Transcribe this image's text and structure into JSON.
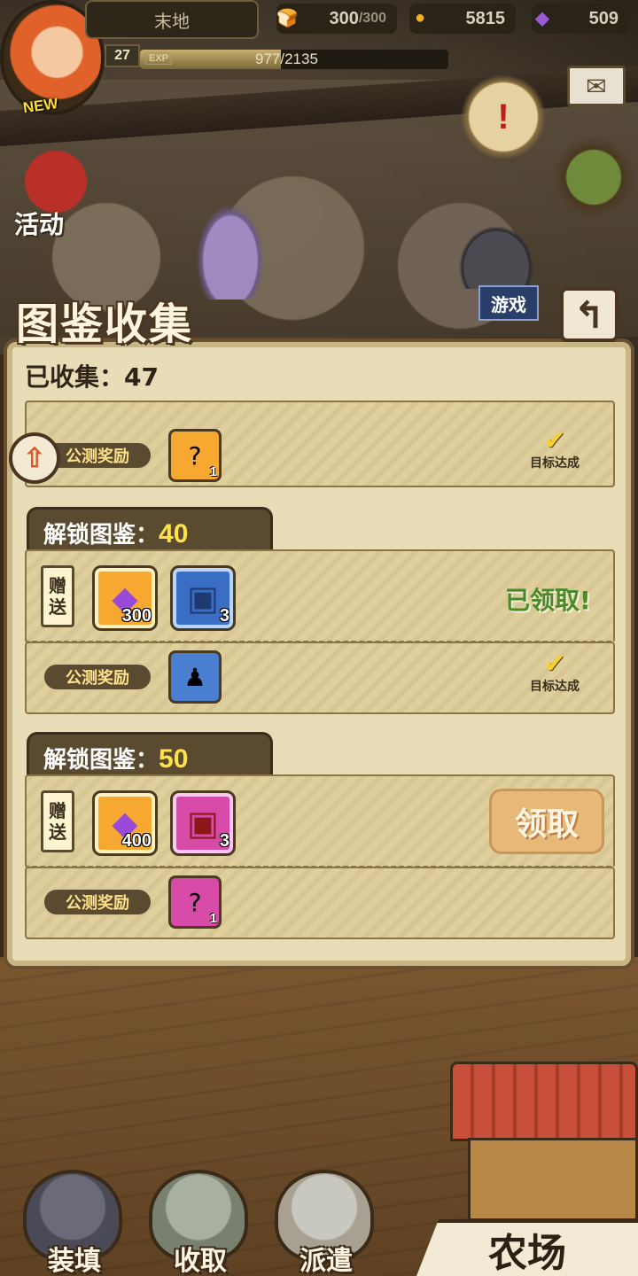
{
  "player": {
    "name": "末地",
    "new_badge": "NEW",
    "level": "27",
    "exp_label": "EXP",
    "exp_text": "977/2135",
    "exp_fraction": 0.4577
  },
  "resources": {
    "stamina": "300",
    "stamina_max": "/300",
    "gold": "5815",
    "gems": "509"
  },
  "side": {
    "event_label": "活动",
    "game_sign": "游戏"
  },
  "panel": {
    "title": "图鉴收集",
    "collected": "已收集：47",
    "tiers": [
      {
        "unlock_label": "解锁图鉴：",
        "unlock_num": "40",
        "gift_tag": [
          "赠",
          "送"
        ],
        "items": [
          {
            "type": "gem",
            "qty": "300"
          },
          {
            "type": "chest-blue",
            "qty": "3"
          }
        ],
        "status": "已领取!",
        "reward_tag": "公测奖励",
        "reward_achieved": "目标达成"
      },
      {
        "unlock_label": "解锁图鉴：",
        "unlock_num": "50",
        "gift_tag": [
          "赠",
          "送"
        ],
        "items": [
          {
            "type": "gem",
            "qty": "400"
          },
          {
            "type": "chest-red",
            "qty": "3"
          }
        ],
        "claim_button": "领取",
        "reward_tag": "公测奖励",
        "reward_qty": "1"
      }
    ],
    "prev_reward": {
      "reward_tag": "公测奖励",
      "qty": "1",
      "achieved": "目标达成"
    }
  },
  "nav": {
    "load": "装填",
    "collect": "收取",
    "dispatch": "派遣",
    "farm": "农场"
  },
  "colors": {
    "accent_yellow": "#ffe24a",
    "claimed_green": "#4a8a2a",
    "panel_bg": "#e9ddb8"
  }
}
